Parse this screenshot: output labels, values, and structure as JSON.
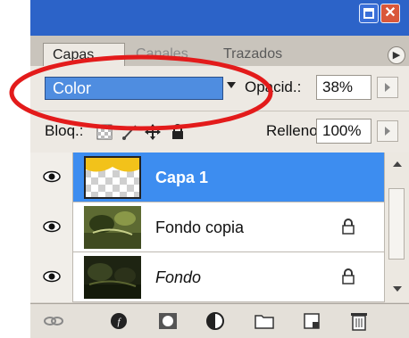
{
  "tabs": [
    {
      "label": "Capas"
    },
    {
      "label": "Canales"
    },
    {
      "label": "Trazados"
    }
  ],
  "blend_mode": {
    "value": "Color"
  },
  "opacity": {
    "label": "Opacid.:",
    "value": "38%"
  },
  "lock": {
    "label": "Bloq.:"
  },
  "fill": {
    "label": "Relleno:",
    "value": "100%"
  },
  "layers": [
    {
      "name": "Capa 1",
      "selected": true,
      "locked": false,
      "italic": false
    },
    {
      "name": "Fondo copia",
      "selected": false,
      "locked": true,
      "italic": false
    },
    {
      "name": "Fondo",
      "selected": false,
      "locked": true,
      "italic": true
    }
  ],
  "colors": {
    "titlebar": "#2c63c8",
    "selection": "#3d8df0",
    "blend_select": "#4f8de0",
    "annotation": "#e31b1b"
  },
  "icons": [
    "minimize-icon",
    "close-icon",
    "panel-menu-icon",
    "dropdown-arrow-icon",
    "lock-transparency-icon",
    "lock-brush-icon",
    "lock-move-icon",
    "lock-all-icon",
    "eye-icon",
    "lock-icon",
    "link-icon",
    "fx-icon",
    "mask-icon",
    "adjustment-icon",
    "folder-icon",
    "new-layer-icon",
    "trash-icon"
  ]
}
